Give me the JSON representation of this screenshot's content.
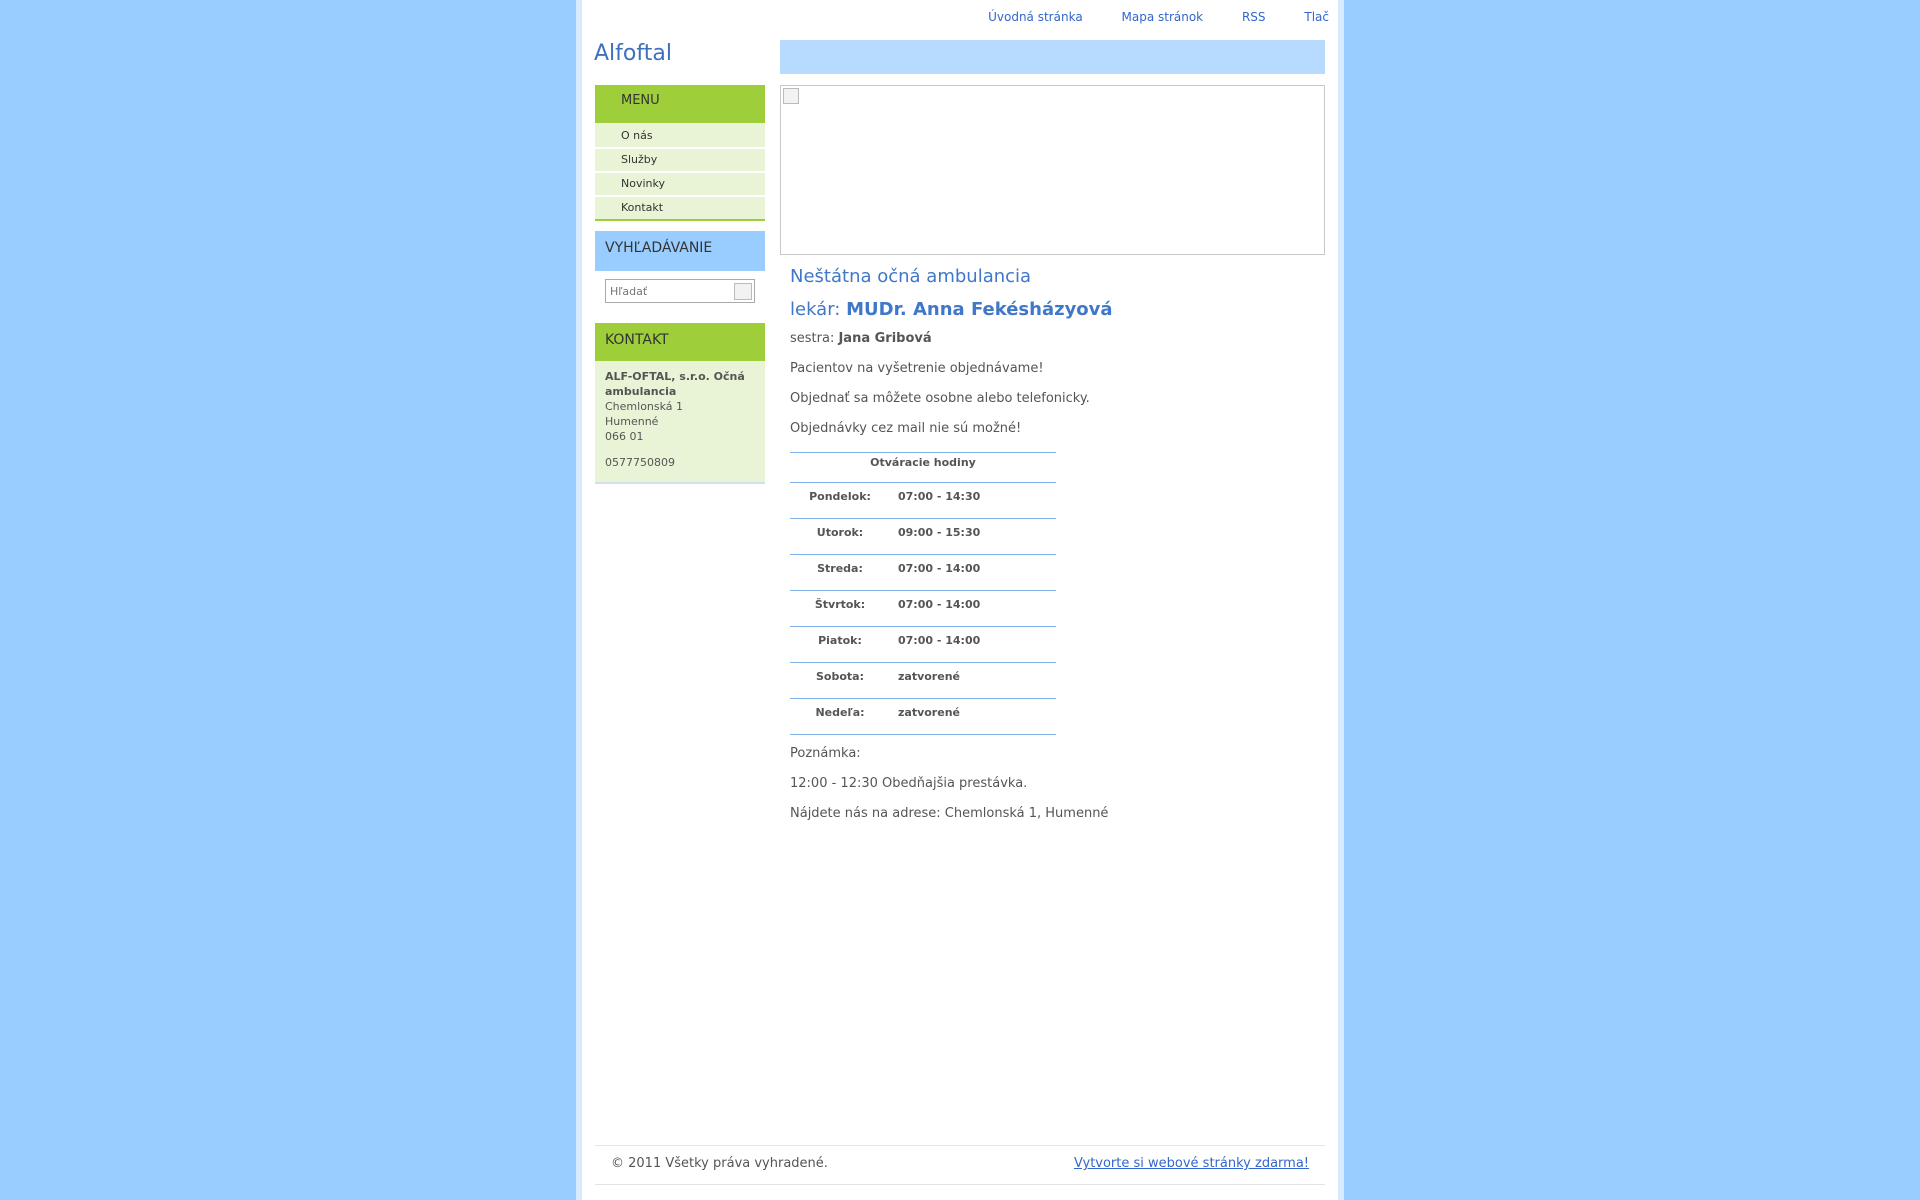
{
  "topnav": {
    "home": "Úvodná stránka",
    "sitemap": "Mapa stránok",
    "rss": "RSS",
    "print": "Tlač"
  },
  "site": {
    "title": "Alfoftal"
  },
  "menu": {
    "heading": "MENU",
    "items": [
      "O nás",
      "Služby",
      "Novinky",
      "Kontakt"
    ]
  },
  "search": {
    "heading": "VYHĽADÁVANIE",
    "placeholder": "Hľadať"
  },
  "contact": {
    "heading": "KONTAKT",
    "company": "ALF-OFTAL, s.r.o. Očná ambulancia",
    "street": "Chemlonská 1",
    "city": "Humenné",
    "zip": "066 01",
    "phone": "0577750809"
  },
  "content": {
    "title": "Neštátna očná ambulancia",
    "doctor_prefix": "lekár: ",
    "doctor_name": "MUDr. Anna Fekésházyová",
    "nurse_prefix": "sestra: ",
    "nurse_name": "Jana Gribová",
    "p1": "Pacientov na vyšetrenie objednávame!",
    "p2": "Objednať sa môžete osobne alebo telefonicky.",
    "p3": "Objednávky cez mail nie sú možné!",
    "hours_heading": "Otváracie hodiny",
    "hours": [
      {
        "day": "Pondelok:",
        "time": "07:00 - 14:30"
      },
      {
        "day": "Utorok:",
        "time": "09:00 - 15:30"
      },
      {
        "day": "Streda:",
        "time": "07:00 - 14:00"
      },
      {
        "day": "Štvrtok:",
        "time": "07:00 - 14:00"
      },
      {
        "day": "Piatok:",
        "time": "07:00 - 14:00"
      },
      {
        "day": "Sobota:",
        "time": "zatvorené"
      },
      {
        "day": "Nedeľa:",
        "time": "zatvorené"
      }
    ],
    "note_label": "Poznámka:",
    "note_text": "12:00 - 12:30 Obedňajšia prestávka.",
    "address": "Nájdete nás na adrese: Chemlonská 1, Humenné"
  },
  "footer": {
    "copyright": "© 2011 Všetky práva vyhradené.",
    "link": "Vytvorte si webové stránky zdarma!"
  }
}
